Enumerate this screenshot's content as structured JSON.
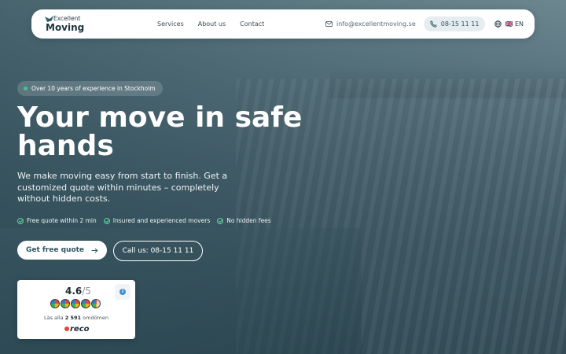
{
  "brand": {
    "line1": "Excellent",
    "line2": "Moving"
  },
  "nav": {
    "links": [
      "Services",
      "About us",
      "Contact"
    ],
    "email": "info@excellentmoving.se",
    "phone": "08-15 11 11",
    "language": "🇬🇧 EN"
  },
  "hero": {
    "badge": "Over 10 years of experience in Stockholm",
    "title": "Your move in safe hands",
    "subtitle": "We make moving easy from start to finish. Get a customized quote within minutes – completely without hidden costs.",
    "features": [
      "Free quote within 2 min",
      "Insured and experienced movers",
      "No hidden fees"
    ],
    "primary_cta": "Get free quote",
    "secondary_cta": "Call us: 08-15 11 11"
  },
  "rating": {
    "score": "4.6",
    "max": "/5",
    "stars_value": 4.6,
    "reviews_prefix": "Läs alla",
    "reviews_count": "2 591",
    "reviews_suffix": "omdömen",
    "provider": "reco"
  },
  "colors": {
    "accent": "#2e5663",
    "check": "#5fd39c",
    "badge_dot": "#49c08b",
    "phone_pill_bg": "#e6edf0"
  }
}
